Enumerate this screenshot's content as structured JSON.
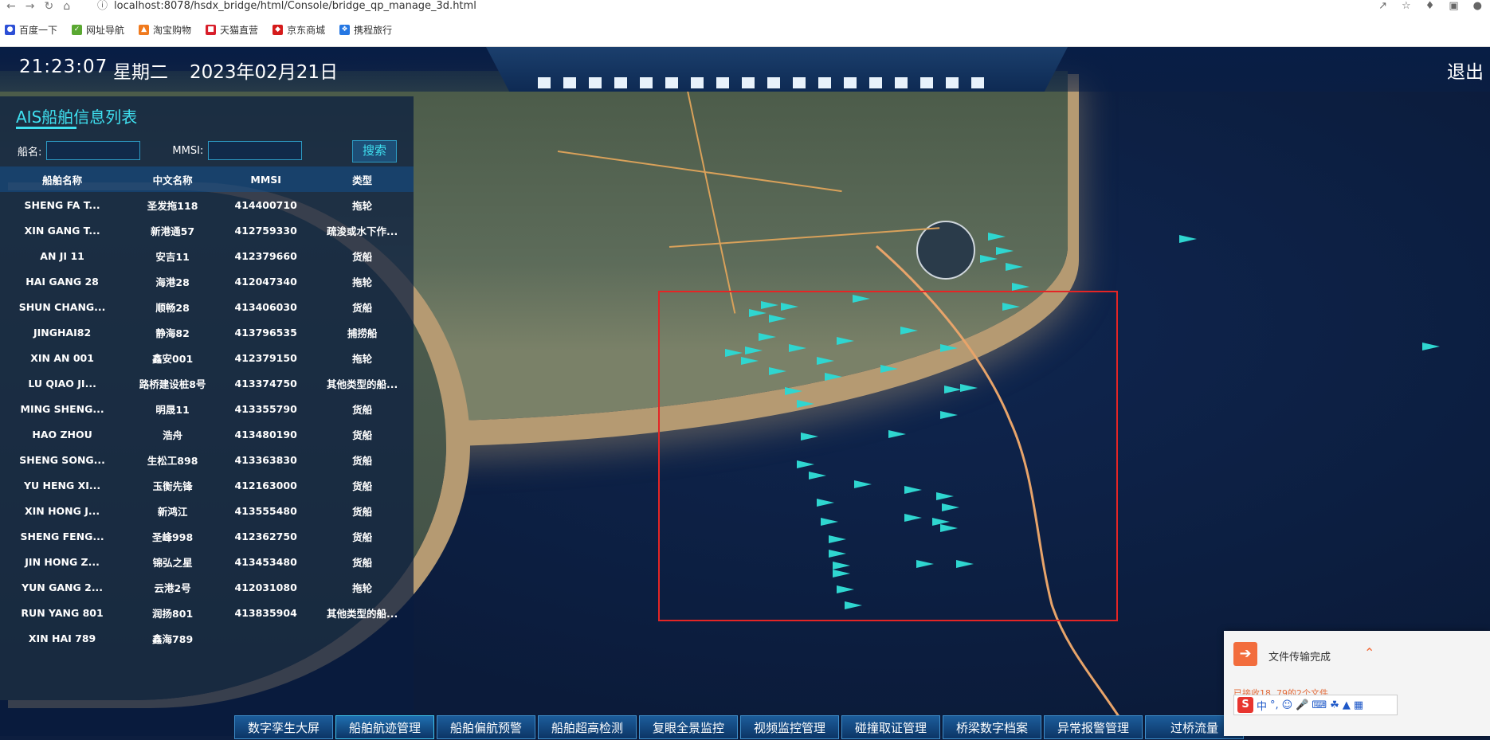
{
  "browser": {
    "url": "localhost:8078/hsdx_bridge/html/Console/bridge_qp_manage_3d.html",
    "bookmarks": [
      "百度一下",
      "网址导航",
      "淘宝购物",
      "天猫直营",
      "京东商城",
      "携程旅行"
    ]
  },
  "header": {
    "time": "21:23:07",
    "weekday": "星期二",
    "date": "2023年02月21日",
    "logout": "退出"
  },
  "panel": {
    "title": "AIS船舶信息列表",
    "ship_name_label": "船名:",
    "mmsi_label": "MMSI:",
    "search_button": "搜索",
    "columns": [
      "船舶名称",
      "中文名称",
      "MMSI",
      "类型"
    ],
    "rows": [
      [
        "SHENG FA T...",
        "圣发拖118",
        "414400710",
        "拖轮"
      ],
      [
        "XIN GANG T...",
        "新港通57",
        "412759330",
        "疏浚或水下作..."
      ],
      [
        "AN JI 11",
        "安吉11",
        "412379660",
        "货船"
      ],
      [
        "HAI GANG 28",
        "海港28",
        "412047340",
        "拖轮"
      ],
      [
        "SHUN CHANG...",
        "顺畅28",
        "413406030",
        "货船"
      ],
      [
        "JINGHAI82",
        "静海82",
        "413796535",
        "捕捞船"
      ],
      [
        "XIN AN 001",
        "鑫安001",
        "412379150",
        "拖轮"
      ],
      [
        "LU QIAO JI...",
        "路桥建设桩8号",
        "413374750",
        "其他类型的船..."
      ],
      [
        "MING SHENG...",
        "明晟11",
        "413355790",
        "货船"
      ],
      [
        "HAO ZHOU",
        "浩舟",
        "413480190",
        "货船"
      ],
      [
        "SHENG SONG...",
        "生松工898",
        "413363830",
        "货船"
      ],
      [
        "YU HENG XI...",
        "玉衡先锋",
        "412163000",
        "货船"
      ],
      [
        "XIN HONG J...",
        "新鸿江",
        "413555480",
        "货船"
      ],
      [
        "SHENG FENG...",
        "圣峰998",
        "412362750",
        "货船"
      ],
      [
        "JIN HONG Z...",
        "锦弘之星",
        "413453480",
        "货船"
      ],
      [
        "YUN GANG 2...",
        "云港2号",
        "412031080",
        "拖轮"
      ],
      [
        "RUN YANG 801",
        "润扬801",
        "413835904",
        "其他类型的船..."
      ],
      [
        "XIN HAI 789",
        "鑫海789",
        "",
        ""
      ]
    ]
  },
  "bottom_nav": [
    "数字孪生大屏",
    "船舶航迹管理",
    "船舶偏航预警",
    "船舶超高检测",
    "复眼全景监控",
    "视频监控管理",
    "碰撞取证管理",
    "桥梁数字档案",
    "异常报警管理",
    "过桥流量"
  ],
  "popup": {
    "title": "文件传输完成",
    "sub": "已接收18, 79的2个文件"
  },
  "ime": "中"
}
